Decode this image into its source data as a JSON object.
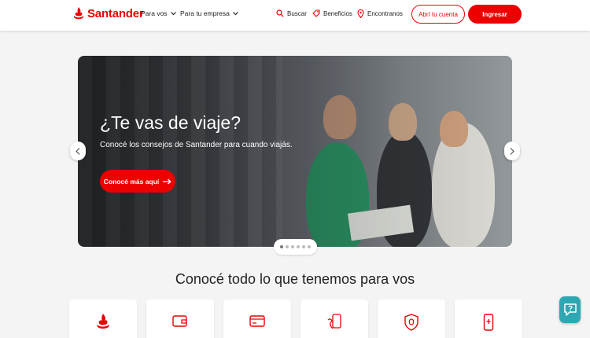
{
  "brand": {
    "name": "Santander",
    "color": "#ec0000"
  },
  "nav": [
    {
      "label": "Para vos"
    },
    {
      "label": "Para tu empresa"
    }
  ],
  "utilities": [
    {
      "label": "Buscar",
      "icon": "search-icon"
    },
    {
      "label": "Beneficios",
      "icon": "tag-icon"
    },
    {
      "label": "Encontranos",
      "icon": "location-pin-icon"
    }
  ],
  "buttons": {
    "open_account": "Abrí tu cuenta",
    "login": "Ingresar"
  },
  "hero": {
    "title": "¿Te vas de viaje?",
    "subtitle": "Conocé los consejos de Santander para cuando viajás.",
    "cta": "Conocé más aquí",
    "slides": 6,
    "active_slide": 1
  },
  "section": {
    "title": "Conocé todo lo que tenemos para vos"
  },
  "cards": [
    {
      "icon": "santander-flame-icon"
    },
    {
      "icon": "wallet-icon"
    },
    {
      "icon": "credit-card-icon"
    },
    {
      "icon": "phone-payment-icon"
    },
    {
      "icon": "shield-icon"
    },
    {
      "icon": "mobile-icon"
    }
  ],
  "help": {
    "icon": "chat-help-icon",
    "color": "#2da8b2"
  }
}
